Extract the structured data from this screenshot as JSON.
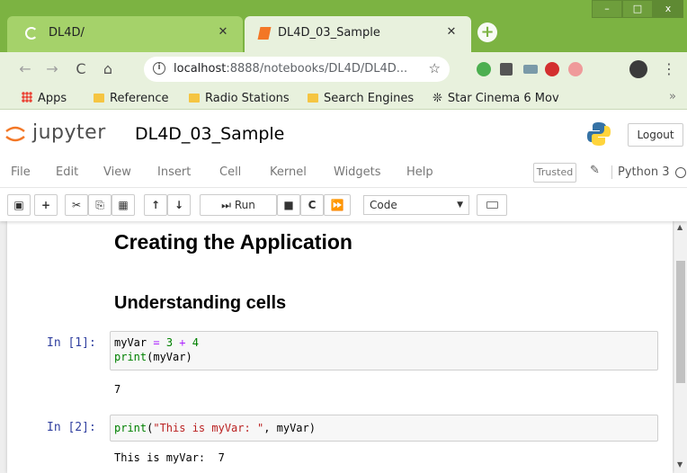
{
  "browser": {
    "tabs": [
      {
        "title": "DL4D/",
        "active": false
      },
      {
        "title": "DL4D_03_Sample",
        "active": true
      }
    ],
    "new_tab": "+",
    "window_controls": {
      "minimize": "–",
      "maximize": "□",
      "close": "x"
    },
    "address": {
      "host": "localhost",
      "path": ":8888/notebooks/DL4D/DL4D..."
    },
    "bookmarks": [
      {
        "label": "Apps",
        "icon": "apps-grid-icon"
      },
      {
        "label": "Reference",
        "icon": "folder-icon"
      },
      {
        "label": "Radio Stations",
        "icon": "folder-icon"
      },
      {
        "label": "Search Engines",
        "icon": "folder-icon"
      },
      {
        "label": "Star Cinema 6 Mov",
        "icon": "film-icon"
      }
    ],
    "bookmarks_more": "»",
    "accent": "#7cb342"
  },
  "jupyter": {
    "wordmark": "jupyter",
    "notebook_name": "DL4D_03_Sample",
    "logout_label": "Logout",
    "menu": [
      "File",
      "Edit",
      "View",
      "Insert",
      "Cell",
      "Kernel",
      "Widgets",
      "Help"
    ],
    "trusted_label": "Trusted",
    "kernel_name": "Python 3",
    "toolbar": {
      "run_label": "Run",
      "cell_type": "Code"
    }
  },
  "notebook": {
    "heading1": "Creating the Application",
    "heading2": "Understanding cells",
    "cells": [
      {
        "prompt": "In [1]:",
        "output": "7"
      },
      {
        "prompt": "In [2]:",
        "output": "This is myVar:  7"
      }
    ]
  }
}
